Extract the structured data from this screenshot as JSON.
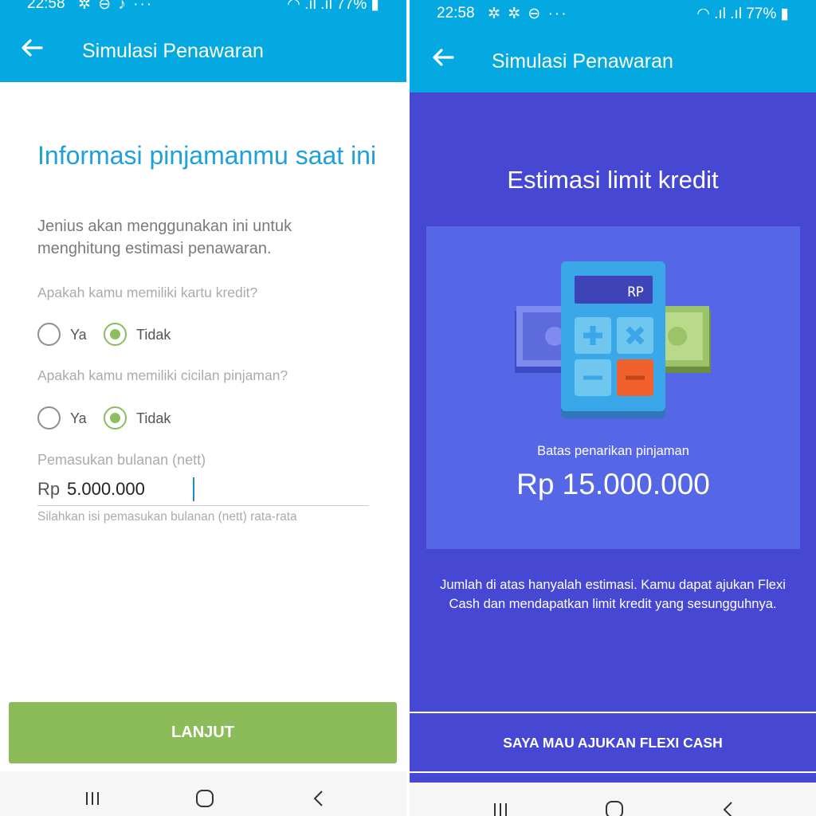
{
  "left_screen": {
    "status": {
      "time": "22:58",
      "battery": "77%"
    },
    "appbar": {
      "title": "Simulasi Penawaran"
    },
    "heading": "Informasi pinjamanmu saat ini",
    "subtitle": "Jenius akan menggunakan ini untuk menghitung estimasi penawaran.",
    "q1": {
      "label": "Apakah kamu memiliki kartu kredit?",
      "options": [
        "Ya",
        "Tidak"
      ],
      "selected": "Tidak"
    },
    "q2": {
      "label": "Apakah kamu memiliki cicilan pinjaman?",
      "options": [
        "Ya",
        "Tidak"
      ],
      "selected": "Tidak"
    },
    "income": {
      "label": "Pemasukan bulanan (nett)",
      "prefix": "Rp",
      "value": "5.000.000",
      "hint": "Silahkan isi pemasukan bulanan (nett) rata-rata"
    },
    "button": "LANJUT"
  },
  "right_screen": {
    "status": {
      "time": "22:58",
      "battery": "77%"
    },
    "appbar": {
      "title": "Simulasi Penawaran"
    },
    "title": "Estimasi limit kredit",
    "calculator_display": "RP",
    "limit_label": "Batas penarikan pinjaman",
    "limit_amount": "Rp 15.000.000",
    "note": "Jumlah di atas hanyalah estimasi. Kamu dapat ajukan Flexi Cash dan mendapatkan limit kredit yang sesungguhnya.",
    "button": "SAYA MAU AJUKAN FLEXI CASH"
  },
  "colors": {
    "primary": "#03A9E0",
    "accent_green": "#8CBB59",
    "purple_bg": "#4647D3",
    "card_bg": "#5566E6",
    "heading_blue": "#1EA0D8"
  },
  "icons": [
    "back-arrow-icon",
    "wifi-icon",
    "signal-icon",
    "battery-icon",
    "calculator-illustration",
    "recents-icon",
    "home-icon",
    "back-nav-icon"
  ]
}
